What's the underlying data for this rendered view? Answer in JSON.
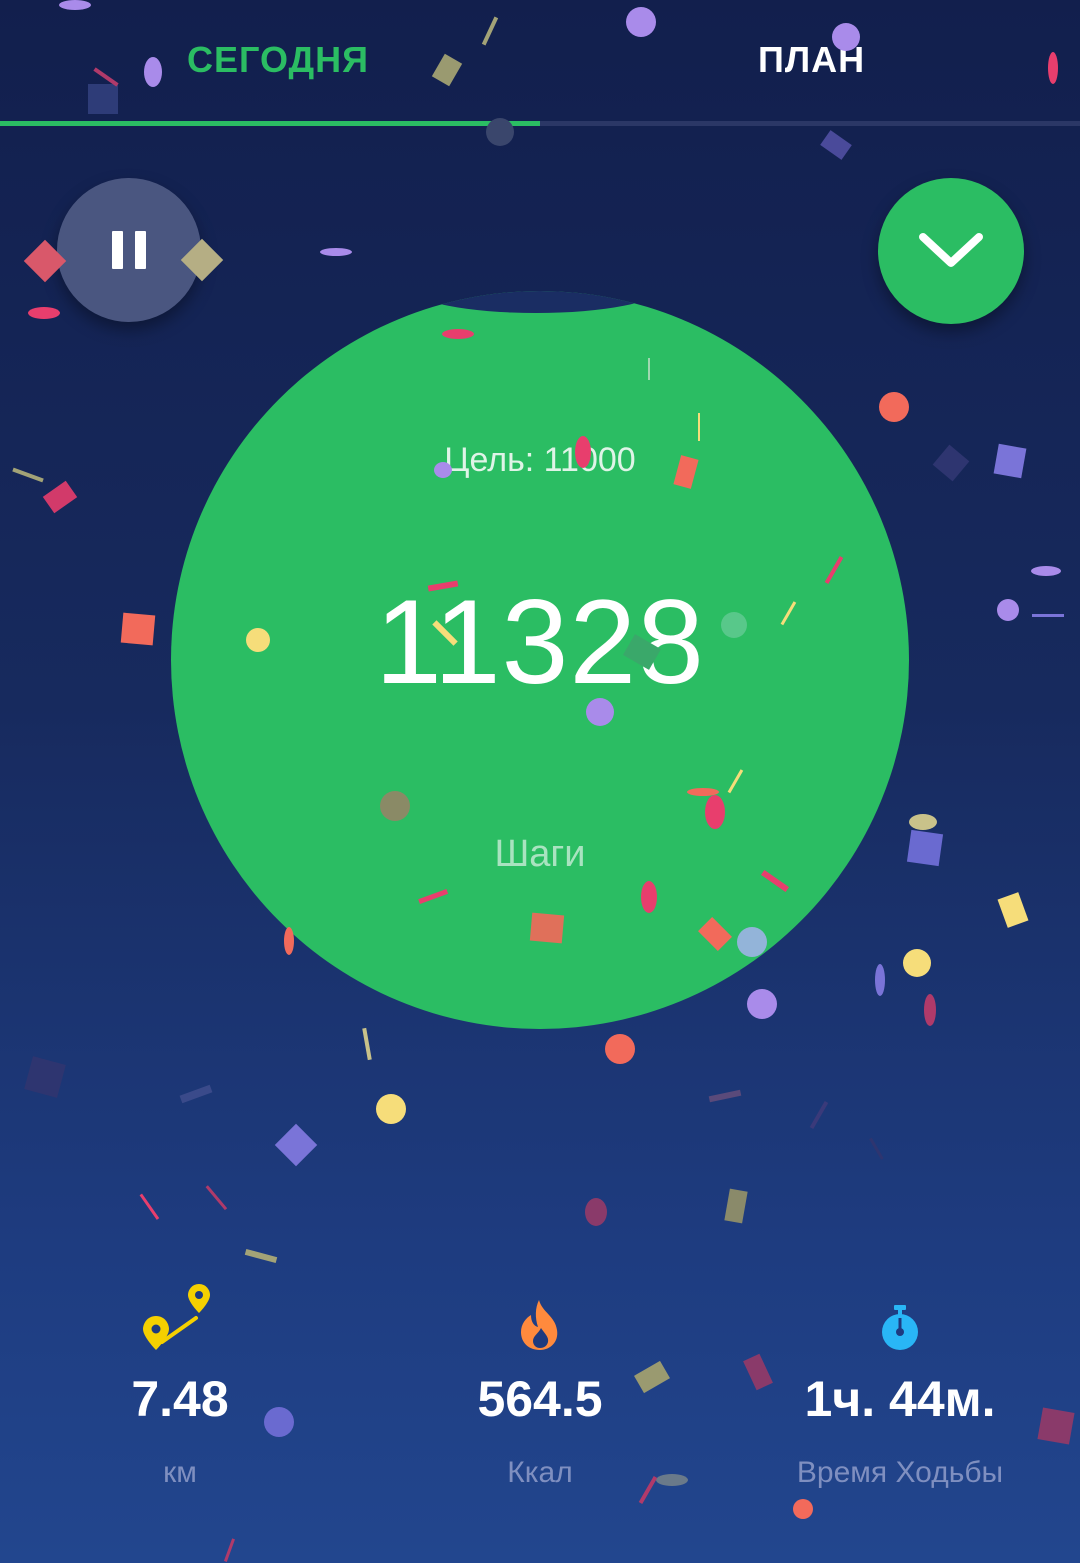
{
  "tabs": [
    {
      "label": "СЕГОДНЯ",
      "active": true
    },
    {
      "label": "ПЛАН",
      "active": false
    }
  ],
  "colors": {
    "accent": "#2bbd63",
    "background_top": "#121f4d",
    "background_bottom": "#22468e"
  },
  "controls": {
    "pause": {
      "icon": "pause-icon"
    },
    "confirm": {
      "icon": "chevron-down-icon"
    }
  },
  "progress": {
    "goal_text": "Цель: 11000",
    "steps_value": "11328",
    "steps_label": "Шаги"
  },
  "stats": [
    {
      "icon": "distance-pins-icon",
      "value": "7.48",
      "label": "км",
      "color": "#f5d000"
    },
    {
      "icon": "flame-icon",
      "value": "564.5",
      "label": "Ккал",
      "color": "#ff8a3d"
    },
    {
      "icon": "stopwatch-icon",
      "value": "1ч. 44м.",
      "label": "Время Ходьбы",
      "color": "#29b6f6"
    }
  ]
}
